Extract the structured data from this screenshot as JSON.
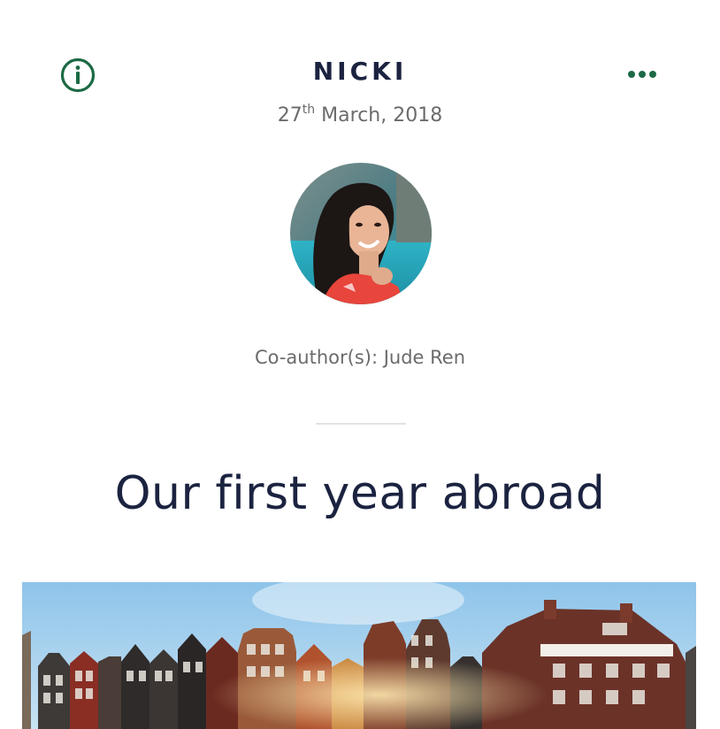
{
  "header": {
    "author_name": "NICKI",
    "date_day": "27",
    "date_suffix": "th",
    "date_rest": " March, 2018",
    "info_icon": "info-circle-icon",
    "more_icon": "more-dots-icon",
    "accent_color": "#1c6a45"
  },
  "post": {
    "coauthors": "Co-author(s): Jude Ren",
    "title": "Our first year abroad",
    "title_color": "#1b2340"
  }
}
